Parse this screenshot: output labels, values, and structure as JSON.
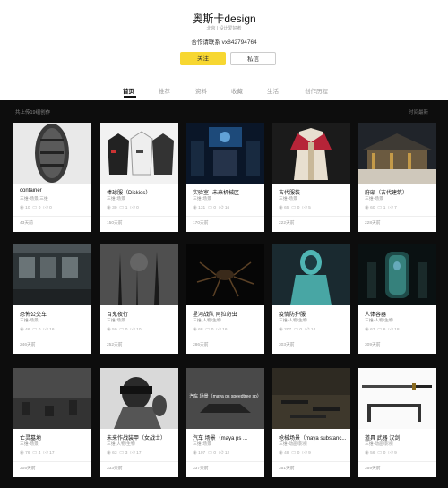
{
  "profile": {
    "name": "奥斯卡design",
    "subtitle": "北京 | 设计爱好者",
    "contact": "合作请联系  vx842794764",
    "follow_label": "关注",
    "message_label": "私信"
  },
  "tabs": [
    "首页",
    "推荐",
    "资料",
    "收藏",
    "生活",
    "创作历程"
  ],
  "section_title": "共上传19组创作",
  "sort_label": "时间最新",
  "overlay_text": "汽车 场景（maya ps speedtree sp）",
  "cards": [
    {
      "title": "container",
      "category": "三维-场景/三维",
      "views": "10",
      "comments": "0",
      "likes": "0",
      "time": "43天前",
      "thumb": "capsule"
    },
    {
      "title": "棒球服（Dickies）",
      "category": "三维-场景",
      "views": "30",
      "comments": "1",
      "likes": "0",
      "time": "150天前",
      "thumb": "jackets"
    },
    {
      "title": "实验室--未来机械区",
      "category": "三维-场景",
      "views": "131",
      "comments": "0",
      "likes": "16",
      "time": "170天前",
      "thumb": "lab"
    },
    {
      "title": "古代服装",
      "category": "三维-场景",
      "views": "65",
      "comments": "0",
      "likes": "5",
      "time": "222天前",
      "thumb": "robe"
    },
    {
      "title": "府邸（古代建筑）",
      "category": "三维-场景",
      "views": "60",
      "comments": "1",
      "likes": "7",
      "time": "228天前",
      "thumb": "palace"
    },
    {
      "title": "恐怖公交车",
      "category": "三维-场景",
      "views": "46",
      "comments": "0",
      "likes": "16",
      "time": "246天前",
      "thumb": "bus"
    },
    {
      "title": "百鬼夜行",
      "category": "三维-场景",
      "views": "50",
      "comments": "0",
      "likes": "10",
      "time": "252天前",
      "thumb": "forest"
    },
    {
      "title": "星河战队 阿拉奇虫",
      "category": "三维-人物/生物",
      "views": "68",
      "comments": "0",
      "likes": "16",
      "time": "286天前",
      "thumb": "spider"
    },
    {
      "title": "疫情防护服",
      "category": "三维-人物/生物",
      "views": "207",
      "comments": "0",
      "likes": "14",
      "time": "303天前",
      "thumb": "hazmat"
    },
    {
      "title": "人体容器",
      "category": "三维-人物/生物",
      "views": "67",
      "comments": "6",
      "likes": "18",
      "time": "309天前",
      "thumb": "pod"
    },
    {
      "title": "亡灵墓地",
      "category": "三维-场景",
      "views": "76",
      "comments": "4",
      "likes": "17",
      "time": "305天前",
      "thumb": "grave"
    },
    {
      "title": "未来作战装甲（女战士）",
      "category": "三维-人物/生物",
      "views": "63",
      "comments": "3",
      "likes": "17",
      "time": "333天前",
      "thumb": "warrior"
    },
    {
      "title": "汽车 场景（maya ps ...",
      "category": "三维-场景",
      "views": "107",
      "comments": "0",
      "likes": "12",
      "time": "337天前",
      "thumb": "car"
    },
    {
      "title": "枪械场景（maya substanc...",
      "category": "三维-动画/影视",
      "views": "48",
      "comments": "0",
      "likes": "9",
      "time": "351天前",
      "thumb": "guns"
    },
    {
      "title": "道具 武器 汉剑",
      "category": "三维-动画/影视",
      "views": "56",
      "comments": "0",
      "likes": "9",
      "time": "359天前",
      "thumb": "sword"
    }
  ]
}
